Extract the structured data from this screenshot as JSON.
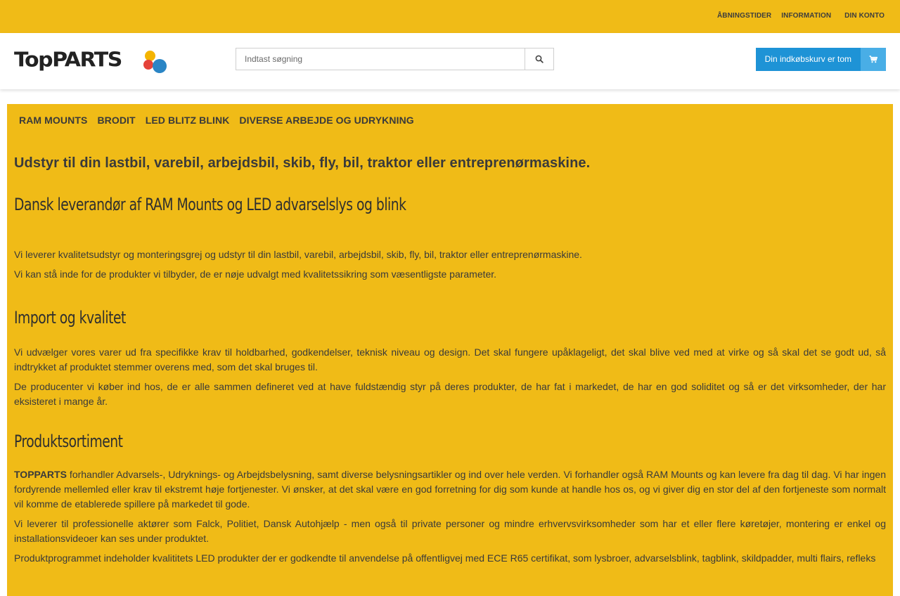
{
  "topbar": {
    "links": [
      "ÅBNINGSTIDER",
      "INFORMATION",
      "DIN KONTO"
    ]
  },
  "header": {
    "logo_text": "TopPARTS",
    "search": {
      "placeholder": "Indtast søgning",
      "value": "",
      "button_icon": "search-icon"
    },
    "cart": {
      "label": "Din indkøbskurv er tom",
      "icon": "shopping-cart-icon"
    }
  },
  "colors": {
    "accent_yellow": "#f0bb17",
    "cart_blue": "#1e93d6",
    "cart_icon_blue": "#49aee6"
  },
  "nav": {
    "items": [
      "RAM MOUNTS",
      "BRODIT",
      "LED BLITZ BLINK",
      "DIVERSE ARBEJDE OG UDRYKNING"
    ]
  },
  "main": {
    "tagline": "Udstyr til din lastbil, varebil, arbejdsbil, skib, fly, bil, traktor eller entreprenørmaskine.",
    "section1": {
      "heading": "Dansk leverandør af RAM Mounts og LED advarselslys og blink",
      "p1": "Vi leverer kvalitetsudstyr og monteringsgrej og udstyr til din lastbil, varebil, arbejdsbil, skib, fly, bil, traktor eller entreprenørmaskine.",
      "p2": "Vi kan stå inde for de produkter vi tilbyder, de er nøje udvalgt med kvalitetssikring som væsentligste parameter."
    },
    "section2": {
      "heading": "Import og kvalitet",
      "p1": "Vi udvælger vores varer ud fra specifikke krav til holdbarhed, godkendelser, teknisk niveau og design. Det skal fungere upåklageligt, det skal blive ved med at virke og så skal det se godt ud, så indtrykket af produktet stemmer overens med, som det skal bruges til.",
      "p2": "De producenter vi køber ind hos, de er alle sammen defineret ved at have fuldstændig styr på deres produkter, de har fat i markedet, de har en god soliditet og så er det virksomheder, der har eksisteret i mange år."
    },
    "section3": {
      "heading": "Produktsortiment",
      "p1_strong": "TOPPARTS",
      "p1_rest": " forhandler Advarsels-, Udryknings- og Arbejdsbelysning, samt diverse belysningsartikler og ind over hele verden. Vi forhandler også RAM Mounts og kan levere fra dag til dag. Vi har ingen fordyrende mellemled eller krav til ekstremt høje fortjenester. Vi ønsker, at det skal være en god forretning for dig som kunde at handle hos os, og vi giver dig en stor del af den fortjeneste som normalt vil komme de etablerede spillere på markedet til gode.",
      "p2": "Vi leverer til professionelle aktører som Falck, Politiet, Dansk Autohjælp - men også til private personer og mindre erhvervsvirksomheder som har et eller flere køretøjer, montering er enkel og installationsvideoer kan ses under produktet.",
      "p3": "Produktprogrammet indeholder kvalititets LED produkter der er godkendte til anvendelse på offentligvej med ECE R65 certifikat, som lysbroer, advarselsblink, tagblink, skildpadder, multi flairs, refleks"
    }
  }
}
